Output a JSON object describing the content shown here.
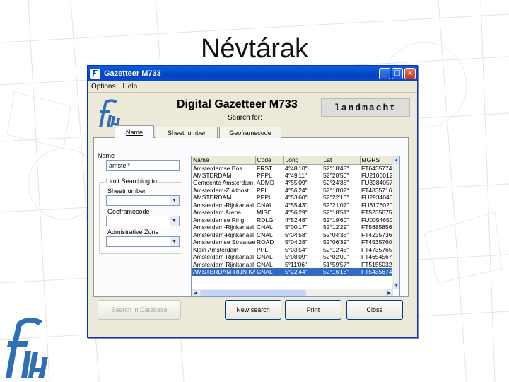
{
  "slide": {
    "title": "Névtárak"
  },
  "window": {
    "title": "Gazetteer M733",
    "menu": [
      "Options",
      "Help"
    ],
    "heading": "Digital Gazetteer M733",
    "search_for": "Search for:",
    "brand": "landmacht",
    "controls": {
      "minimize": "_",
      "maximize": "□",
      "close": "×"
    }
  },
  "tabs": [
    {
      "label": "Name",
      "active": true
    },
    {
      "label": "Sheetnumber",
      "active": false
    },
    {
      "label": "Geoframecode",
      "active": false
    }
  ],
  "form": {
    "name_label": "Name",
    "name_value": "amstel*",
    "limit_label": "Limit Searching to",
    "sheetnumber_label": "Sheetnumber",
    "geoframecode_label": "Geoframecode",
    "admin_zone_label": "Admistrative Zone"
  },
  "results": {
    "columns": [
      "Name",
      "Code",
      "Long",
      "Lat",
      "MGRS"
    ],
    "rows": [
      [
        "Amsterdamse Bos",
        "FRST",
        "4°48'10\"",
        "52°18'48\"",
        "FT6435774"
      ],
      [
        "AMSTERDAM",
        "PPPL",
        "4°49'11\"",
        "52°20'50\"",
        "FU2100012"
      ],
      [
        "Gemeente Amsterdam",
        "ADMD",
        "4°55'09\"",
        "52°24'38\"",
        "FU3984057"
      ],
      [
        "Amsterdam-Zuidoost",
        "PPL",
        "4°56'24\"",
        "52°18'02\"",
        "FT4835716"
      ],
      [
        "AMSTERDAM",
        "PPPL",
        "4°53'60\"",
        "52°22'16\"",
        "FU2934040"
      ],
      [
        "Amsterdam-Rijnkanaal",
        "CNAL",
        "4°55'43\"",
        "52°21'07\"",
        "FU3176020"
      ],
      [
        "Amsterdam Arena",
        "MISC",
        "4°56'29\"",
        "52°18'51\"",
        "FT5235675"
      ],
      [
        "Amsterdamse Ring",
        "RDLG",
        "4°52'48\"",
        "52°19'60\"",
        "FU0054650"
      ],
      [
        "Amsterdam-Rijnkanaal",
        "CNAL",
        "5°00'17\"",
        "52°12'29\"",
        "FT5685856"
      ],
      [
        "Amsterdam-Rijnkanaal",
        "CNAL",
        "5°04'58\"",
        "52°04'36\"",
        "FT4235736"
      ],
      [
        "Amsterdamse Straatweg",
        "ROAD",
        "5°04'28\"",
        "52°06'39\"",
        "FT4535760"
      ],
      [
        "Klein Amsterdam",
        "PPL",
        "5°03'54\"",
        "52°12'48\"",
        "FT4735765"
      ],
      [
        "Amsterdam-Rijnkanaal",
        "CNAL",
        "5°08'09\"",
        "52°02'00\"",
        "FT4654567"
      ],
      [
        "Amsterdam-Rijnkanaal",
        "CNAL",
        "5°11'06\"",
        "51°59'57\"",
        "FT5155032"
      ],
      [
        "AMSTERDAM-RIJN KAN",
        "CNAL",
        "5°22'44\"",
        "52°16'13\"",
        "FT5435674"
      ]
    ],
    "selected_row": 14
  },
  "buttons": {
    "search": "Search in Database",
    "new_search": "New search",
    "print": "Print",
    "close": "Close"
  },
  "colors": {
    "titlebar": "#0342c5",
    "selection": "#316ac5",
    "window_bg": "#ece9d8"
  }
}
